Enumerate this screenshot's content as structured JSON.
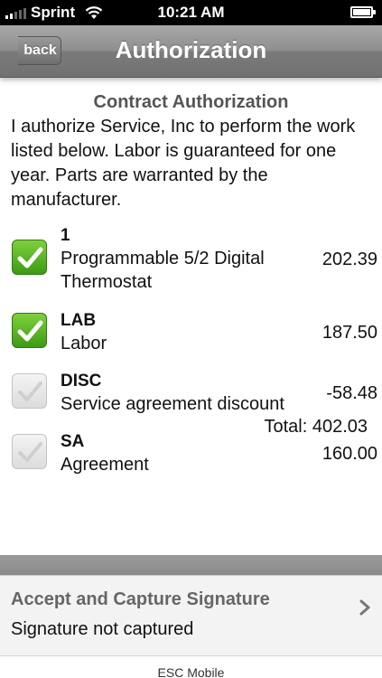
{
  "status_bar": {
    "carrier": "Sprint",
    "time": "10:21 AM"
  },
  "nav": {
    "back_label": "back",
    "title": "Authorization"
  },
  "contract": {
    "title": "Contract Authorization",
    "text": "I authorize Service, Inc to perform the work listed below. Labor is guaranteed for one year. Parts are warranted by the manufacturer."
  },
  "items": [
    {
      "code": "1",
      "description": "Programmable 5/2 Digital Thermostat",
      "amount": "202.39",
      "checked": true
    },
    {
      "code": "LAB",
      "description": "Labor",
      "amount": "187.50",
      "checked": true
    },
    {
      "code": "DISC",
      "description": "Service agreement discount",
      "amount": "-58.48",
      "checked": false
    },
    {
      "code": "SA",
      "description": "Agreement",
      "amount": "160.00",
      "checked": false
    }
  ],
  "total": "Total: 402.03",
  "signature": {
    "title": "Accept and Capture Signature",
    "status": "Signature not captured"
  },
  "footer": {
    "brand": "ESC Mobile"
  },
  "colors": {
    "checked_green": "#4fae1f",
    "nav_gray": "#8e8e8e",
    "divider_gray": "#929292"
  }
}
